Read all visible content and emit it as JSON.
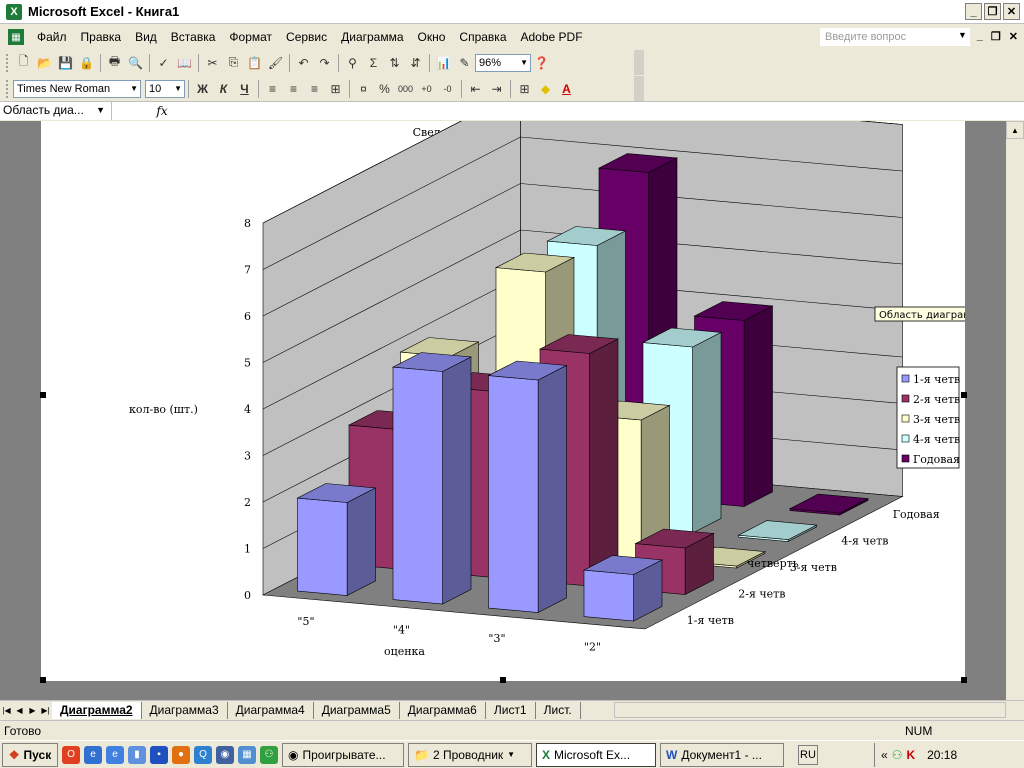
{
  "window": {
    "title": "Microsoft Excel - Книга1"
  },
  "menu": {
    "items": [
      "Файл",
      "Правка",
      "Вид",
      "Вставка",
      "Формат",
      "Сервис",
      "Диаграмма",
      "Окно",
      "Справка",
      "Adobe PDF"
    ],
    "help_placeholder": "Введите вопрос"
  },
  "toolbar": {
    "zoom": "96%",
    "font_name": "Times New Roman",
    "font_size": "10",
    "bold": "Ж",
    "italic": "К",
    "underline": "Ч"
  },
  "formula_bar": {
    "name_box": "Область диа...",
    "fx_label": "fx"
  },
  "tooltip": "Область диаграммы",
  "chart_data": {
    "type": "bar",
    "subtype": "3d-column",
    "title": "Сведения об успеваемости",
    "xlabel": "оценка",
    "ylabel": "кол-во (шт.)",
    "zlabel": "четверть",
    "ylim": [
      0,
      8
    ],
    "yticks": [
      "0",
      "1",
      "2",
      "3",
      "4",
      "5",
      "6",
      "7",
      "8"
    ],
    "categories": [
      "\"5\"",
      "\"4\"",
      "\"3\"",
      "\"2\""
    ],
    "series": [
      {
        "name": "1-я четв",
        "color": "#9999ff",
        "values": [
          2,
          5,
          5,
          1
        ]
      },
      {
        "name": "2-я четв",
        "color": "#993366",
        "values": [
          3,
          4,
          5,
          1
        ]
      },
      {
        "name": "3-я четв",
        "color": "#ffffcc",
        "values": [
          4,
          6,
          3,
          0
        ]
      },
      {
        "name": "4-я четв",
        "color": "#ccffff",
        "values": [
          0,
          6,
          4,
          0
        ]
      },
      {
        "name": "Годовая",
        "color": "#660066",
        "values": [
          0,
          7,
          4,
          0
        ]
      }
    ],
    "grid": true,
    "legend": "right"
  },
  "sheets": {
    "tabs": [
      "Диаграмма2",
      "Диаграмма3",
      "Диаграмма4",
      "Диаграмма5",
      "Диаграмма6",
      "Лист1",
      "Лист."
    ],
    "active": "Диаграмма2"
  },
  "status": {
    "ready": "Готово",
    "num": "NUM"
  },
  "taskbar": {
    "start": "Пуск",
    "buttons": [
      "Проигрывате...",
      "2 Проводник",
      "Microsoft Ex...",
      "Документ1 - ..."
    ],
    "lang": "RU",
    "clock": "20:18"
  }
}
